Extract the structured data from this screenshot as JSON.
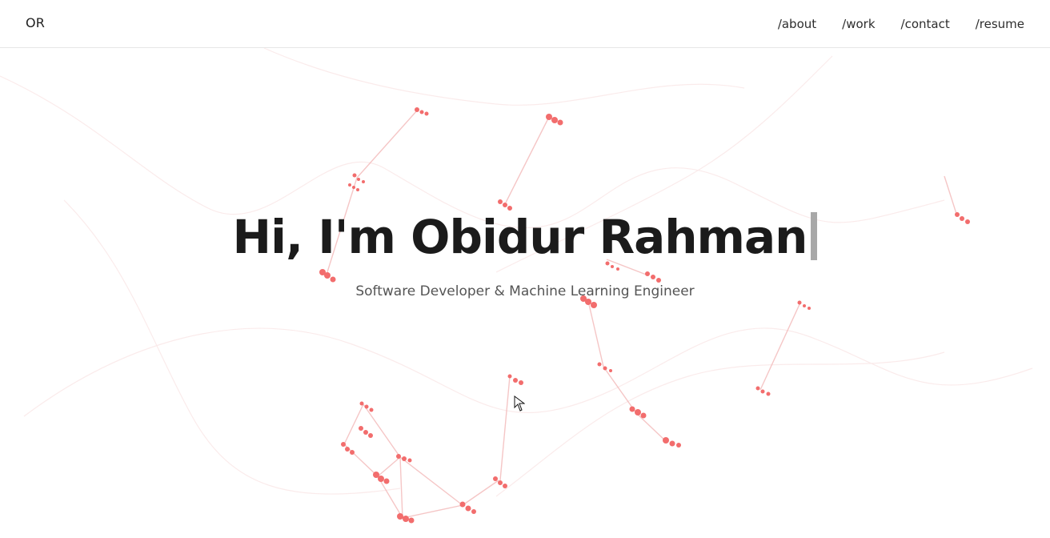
{
  "navbar": {
    "logo": "OR",
    "links": [
      "/about",
      "/work",
      "/contact",
      "/resume"
    ]
  },
  "hero": {
    "title": "Hi, I'm Obidur Rahman",
    "subtitle": "Software Developer & Machine Learning Engineer"
  },
  "background": {
    "particle_color": "#f26d6d",
    "line_color": "#f2b3b3"
  },
  "icons": {
    "cursor": "mouse-pointer-icon",
    "typing_caret": "typing-cursor-icon"
  }
}
